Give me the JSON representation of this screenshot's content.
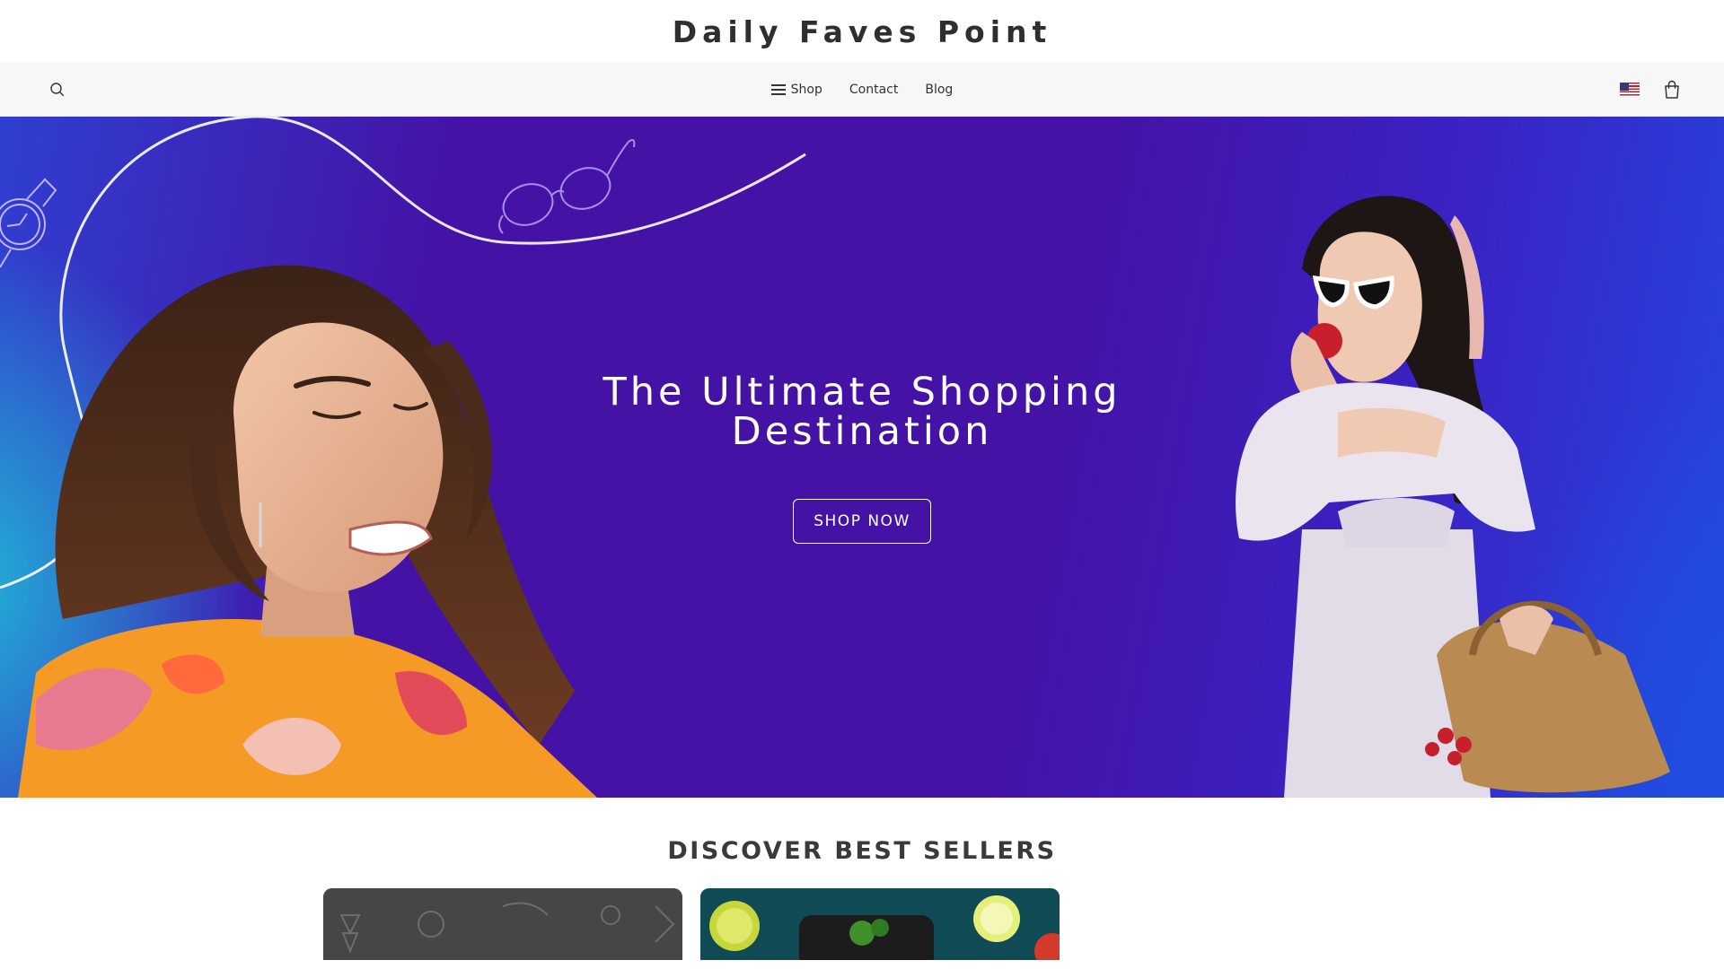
{
  "brand": {
    "title": "Daily Faves Point"
  },
  "nav": {
    "links": [
      {
        "label": "Shop",
        "icon": "hamburger-menu-icon"
      },
      {
        "label": "Contact"
      },
      {
        "label": "Blog"
      }
    ],
    "search_icon": "search-icon",
    "flag_icon": "us-flag-icon",
    "cart_icon": "shopping-bag-icon"
  },
  "hero": {
    "headline": "The Ultimate Shopping Destination",
    "cta_label": "SHOP NOW"
  },
  "best_sellers": {
    "title": "DISCOVER BEST SELLERS"
  },
  "colors": {
    "hero_purple": "#4413a6",
    "hero_blue": "#2447de",
    "hero_cyan": "#22b3d6",
    "nav_bg": "#f7f7f7"
  }
}
